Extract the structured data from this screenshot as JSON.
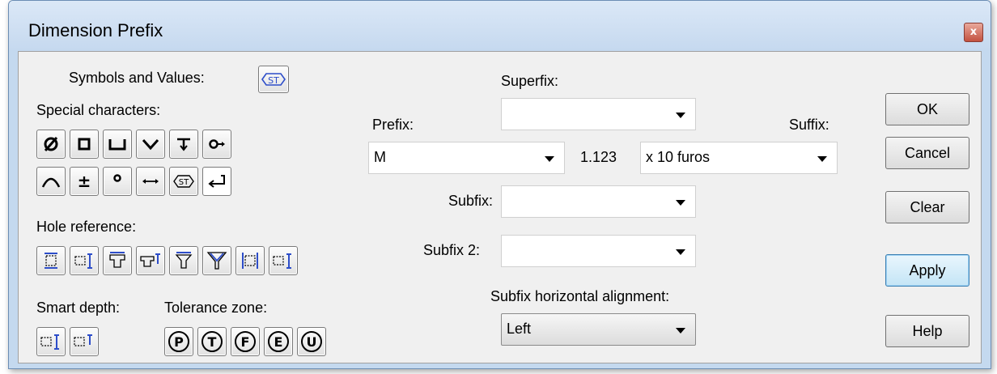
{
  "window": {
    "title": "Dimension Prefix",
    "close_label": "x"
  },
  "left": {
    "symbols_label": "Symbols and Values:",
    "special_label": "Special characters:",
    "hole_label": "Hole reference:",
    "smart_depth_label": "Smart depth:",
    "tolerance_label": "Tolerance zone:",
    "special_row1": [
      "diameter-icon",
      "square-icon",
      "counterbore-icon",
      "countersink-icon",
      "depth-icon",
      "arrow-right-icon"
    ],
    "special_row2": [
      "arc-icon",
      "plus-minus-icon",
      "degree-icon",
      "between-icon",
      "symbol-st-icon",
      "newline-icon"
    ],
    "plus_minus_glyph": "±",
    "tolerance_letters": [
      "P",
      "T",
      "F",
      "E",
      "U"
    ],
    "st_glyph": "ST"
  },
  "middle": {
    "superfix_label": "Superfix:",
    "superfix_value": "",
    "prefix_label": "Prefix:",
    "prefix_value": "M",
    "dimension_value": "1.123",
    "suffix_label": "Suffix:",
    "suffix_value": "x 10 furos",
    "subfix_label": "Subfix:",
    "subfix_value": "",
    "subfix2_label": "Subfix 2:",
    "subfix2_value": "",
    "alignment_label": "Subfix horizontal alignment:",
    "alignment_value": "Left"
  },
  "buttons": {
    "ok": "OK",
    "cancel": "Cancel",
    "clear": "Clear",
    "apply": "Apply",
    "help": "Help"
  },
  "colors": {
    "icon_blue": "#2d4dc9",
    "focus_blue": "#3c7fb1",
    "title_bg": "#c6d9ef"
  }
}
